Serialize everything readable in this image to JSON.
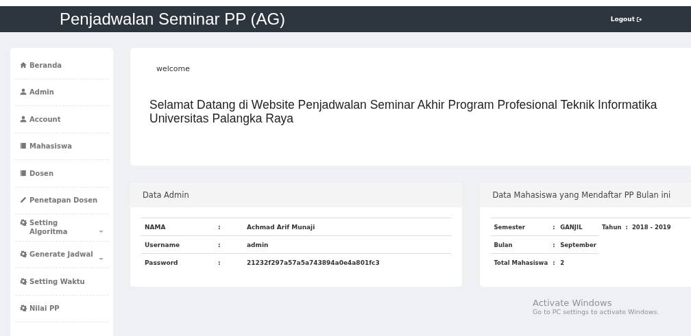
{
  "header": {
    "title": "Penjadwalan Seminar PP (AG)",
    "logout": "Logout"
  },
  "sidebar": {
    "items": [
      {
        "label": "Beranda",
        "kind": "home",
        "expandable": false
      },
      {
        "label": "Admin",
        "kind": "user",
        "expandable": false
      },
      {
        "label": "Account",
        "kind": "user",
        "expandable": false
      },
      {
        "label": "Mahasiswa",
        "kind": "book",
        "expandable": false
      },
      {
        "label": "Dosen",
        "kind": "book",
        "expandable": false
      },
      {
        "label": "Penetapan Dosen",
        "kind": "pencil",
        "expandable": false
      },
      {
        "label": "Setting Algoritma",
        "kind": "gear",
        "expandable": true
      },
      {
        "label": "Generate Jadwal",
        "kind": "gear",
        "expandable": true
      },
      {
        "label": "Setting Waktu",
        "kind": "gear",
        "expandable": false
      },
      {
        "label": "Nilai PP",
        "kind": "gear",
        "expandable": false
      }
    ]
  },
  "welcome": {
    "label": "welcome",
    "message": "Selamat Datang di Website Penjadwalan Seminar Akhir Program Profesional Teknik Informatika Universitas Palangka Raya"
  },
  "admin_card": {
    "title": "Data Admin",
    "rows": [
      {
        "label": "NAMA",
        "separator": ":",
        "value": "Achmad Arif Munaji"
      },
      {
        "label": "Username",
        "separator": ":",
        "value": "admin"
      },
      {
        "label": "Password",
        "separator": ":",
        "value": "21232f297a57a5a743894a0e4a801fc3"
      }
    ]
  },
  "mahasiswa_card": {
    "title": "Data Mahasiswa yang Mendaftar PP Bulan ini",
    "rows": [
      {
        "label": "Semester",
        "separator": ":",
        "value": "GANJIL"
      },
      {
        "label": "Bulan",
        "separator": ":",
        "value": "September"
      },
      {
        "label": "Total Mahasiswa",
        "separator": ":",
        "value": "2"
      }
    ],
    "side": {
      "label": "Tahun",
      "separator": ":",
      "value": "2018 - 2019"
    }
  },
  "os_notice": {
    "title": "Activate Windows",
    "text": "Go to PC settings to activate Windows."
  }
}
